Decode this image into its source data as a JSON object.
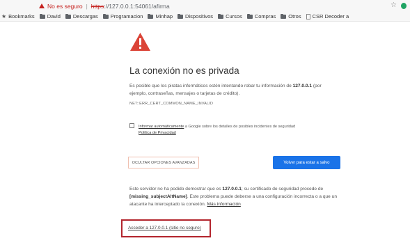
{
  "browser": {
    "security_label": "No es seguro",
    "url_scheme": "https",
    "url_rest": "://127.0.0.1:54061/afirma",
    "bookmarks": [
      {
        "label": "Bookmarks",
        "icon": "star-icon"
      },
      {
        "label": "David",
        "icon": "folder-icon"
      },
      {
        "label": "Descargas",
        "icon": "folder-icon"
      },
      {
        "label": "Programacion",
        "icon": "folder-icon"
      },
      {
        "label": "Minhap",
        "icon": "folder-icon"
      },
      {
        "label": "Dispositivos",
        "icon": "folder-icon"
      },
      {
        "label": "Cursos",
        "icon": "folder-icon"
      },
      {
        "label": "Compras",
        "icon": "folder-icon"
      },
      {
        "label": "Otros",
        "icon": "folder-icon"
      },
      {
        "label": "CSR Decoder a",
        "icon": "page-icon"
      }
    ]
  },
  "interstitial": {
    "title": "La conexión no es privada",
    "explain_pre": "Es posible que los piratas informáticos estén intentando robar tu información de ",
    "explain_host": "127.0.0.1",
    "explain_post": " (por ejemplo, contraseñas, mensajes o tarjetas de crédito).",
    "error_code": "NET::ERR_CERT_COMMON_NAME_INVALID",
    "report_link": "Informar automáticamente",
    "report_rest": " a Google sobre los detalles de posibles incidentes de seguridad",
    "privacy_link": "Política de Privacidad",
    "advanced_button": "OCULTAR OPCIONES AVANZADAS",
    "back_button": "Volver para estar a salvo",
    "details_pre": "Este servidor no ha podido demostrar que es ",
    "details_host": "127.0.0.1",
    "details_mid": "; su certificado de seguridad procede de ",
    "details_cert": "[missing_subjectAltName]",
    "details_post": ". Este problema puede deberse a una configuración incorrecta o a que un atacante ha interceptado la conexión. ",
    "more_info_link": "Más información",
    "proceed_link": "Acceder a 127.0.0.1 (sitio no seguro)"
  },
  "colors": {
    "danger": "#db4437",
    "primary_button": "#1a73e8",
    "highlight_box": "#b3252d"
  }
}
